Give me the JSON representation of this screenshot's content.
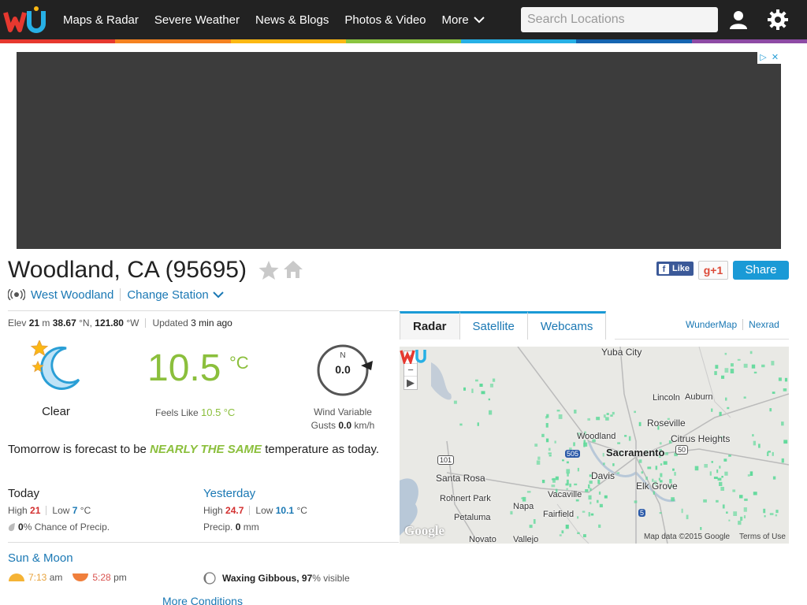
{
  "nav": {
    "links": [
      "Maps & Radar",
      "Severe Weather",
      "News & Blogs",
      "Photos & Video"
    ],
    "more_label": "More",
    "search_placeholder": "Search Locations"
  },
  "colors": {
    "rainbow": [
      "#e6382f",
      "#f58220",
      "#fcb813",
      "#8ac440",
      "#27b0e5",
      "#1565b1",
      "#8e4ba5"
    ],
    "temp_green": "#8bbf3c",
    "link_blue": "#1a78b4",
    "share_blue": "#1a9ad6"
  },
  "location": {
    "title": "Woodland, CA (95695)",
    "station": "West Woodland",
    "change_station": "Change Station"
  },
  "social": {
    "like": "Like",
    "gplus": "g+1",
    "share": "Share"
  },
  "elev": {
    "label": "Elev",
    "value": "21",
    "unit": "m",
    "lat": "38.67",
    "lat_unit": "°N,",
    "lon": "121.80",
    "lon_unit": "°W",
    "updated_label": "Updated",
    "updated_value": "3 min ago"
  },
  "current": {
    "condition": "Clear",
    "temp": "10.5",
    "temp_unit": "°C",
    "feels_label": "Feels Like",
    "feels_value": "10.5",
    "feels_unit": "°C",
    "wind_dir": "N",
    "wind_speed": "0.0",
    "wind_text": "Wind Variable",
    "gusts_label": "Gusts",
    "gusts_value": "0.0",
    "gusts_unit": "km/h"
  },
  "forecast": {
    "prefix": "Tomorrow is forecast to be",
    "highlight": "NEARLY THE SAME",
    "suffix": "temperature as today."
  },
  "today": {
    "heading": "Today",
    "high_label": "High",
    "high": "21",
    "low_label": "Low",
    "low": "7",
    "unit": "°C",
    "precip_value": "0",
    "precip_text": "% Chance of Precip."
  },
  "yesterday": {
    "heading": "Yesterday",
    "high_label": "High",
    "high": "24.7",
    "low_label": "Low",
    "low": "10.1",
    "unit": "°C",
    "precip_label": "Precip.",
    "precip_value": "0",
    "precip_unit": "mm"
  },
  "sunmoon": {
    "heading": "Sun & Moon",
    "sunrise": "7:13",
    "sunrise_unit": "am",
    "sunset": "5:28",
    "sunset_unit": "pm",
    "moon_phase": "Waxing Gibbous,",
    "moon_pct": "97",
    "moon_text": "% visible",
    "more_conditions": "More Conditions"
  },
  "tabs": [
    "Radar",
    "Satellite",
    "Webcams"
  ],
  "maplinks": [
    "WunderMap",
    "Nexrad"
  ],
  "map": {
    "cities": [
      "Yuba City",
      "Lincoln",
      "Auburn",
      "Roseville",
      "Citrus Heights",
      "Woodland",
      "Sacramento",
      "Davis",
      "Elk Grove",
      "Santa Rosa",
      "Rohnert Park",
      "Vacaville",
      "Napa",
      "Fairfield",
      "Petaluma",
      "Novato",
      "Vallejo"
    ],
    "shields": [
      "101",
      "505",
      "50",
      "5"
    ],
    "google": "Google",
    "data_credit": "Map data ©2015 Google",
    "terms": "Terms of Use"
  }
}
